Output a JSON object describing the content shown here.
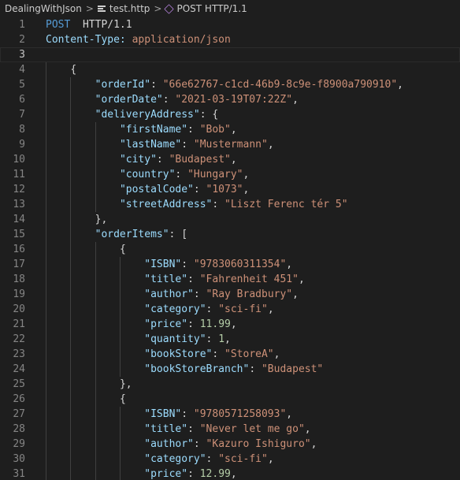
{
  "breadcrumb": {
    "folder": "DealingWithJson",
    "file": "test.http",
    "request": "POST HTTP/1.1",
    "separator": ">"
  },
  "colors": {
    "background": "#1e1e1e",
    "line_number": "#858585",
    "keyword": "#569cd6",
    "property": "#9cdcfe",
    "string": "#ce9178",
    "number": "#b5cea8",
    "punctuation": "#d4d4d4"
  },
  "icons": {
    "file": "file-lines-icon",
    "request": "method-cube-icon"
  },
  "editor": {
    "current_line": 3,
    "lines": [
      {
        "n": "1",
        "indent": 0,
        "tokens": [
          [
            "k",
            "POST"
          ],
          [
            "p",
            "  HTTP/1.1"
          ]
        ]
      },
      {
        "n": "2",
        "indent": 0,
        "tokens": [
          [
            "h",
            "Content-Type:"
          ],
          [
            "s",
            " application/json"
          ]
        ]
      },
      {
        "n": "3",
        "indent": 0,
        "tokens": []
      },
      {
        "n": "4",
        "indent": 1,
        "tokens": [
          [
            "p",
            "{"
          ]
        ]
      },
      {
        "n": "5",
        "indent": 2,
        "tokens": [
          [
            "h",
            "\"orderId\""
          ],
          [
            "p",
            ": "
          ],
          [
            "s",
            "\"66e62767-c1cd-46b9-8c9e-f8900a790910\""
          ],
          [
            "p",
            ","
          ]
        ]
      },
      {
        "n": "6",
        "indent": 2,
        "tokens": [
          [
            "h",
            "\"orderDate\""
          ],
          [
            "p",
            ": "
          ],
          [
            "s",
            "\"2021-03-19T07:22Z\""
          ],
          [
            "p",
            ","
          ]
        ]
      },
      {
        "n": "7",
        "indent": 2,
        "tokens": [
          [
            "h",
            "\"deliveryAddress\""
          ],
          [
            "p",
            ": {"
          ]
        ]
      },
      {
        "n": "8",
        "indent": 3,
        "tokens": [
          [
            "h",
            "\"firstName\""
          ],
          [
            "p",
            ": "
          ],
          [
            "s",
            "\"Bob\""
          ],
          [
            "p",
            ","
          ]
        ]
      },
      {
        "n": "9",
        "indent": 3,
        "tokens": [
          [
            "h",
            "\"lastName\""
          ],
          [
            "p",
            ": "
          ],
          [
            "s",
            "\"Mustermann\""
          ],
          [
            "p",
            ","
          ]
        ]
      },
      {
        "n": "10",
        "indent": 3,
        "tokens": [
          [
            "h",
            "\"city\""
          ],
          [
            "p",
            ": "
          ],
          [
            "s",
            "\"Budapest\""
          ],
          [
            "p",
            ","
          ]
        ]
      },
      {
        "n": "11",
        "indent": 3,
        "tokens": [
          [
            "h",
            "\"country\""
          ],
          [
            "p",
            ": "
          ],
          [
            "s",
            "\"Hungary\""
          ],
          [
            "p",
            ","
          ]
        ]
      },
      {
        "n": "12",
        "indent": 3,
        "tokens": [
          [
            "h",
            "\"postalCode\""
          ],
          [
            "p",
            ": "
          ],
          [
            "s",
            "\"1073\""
          ],
          [
            "p",
            ","
          ]
        ]
      },
      {
        "n": "13",
        "indent": 3,
        "tokens": [
          [
            "h",
            "\"streetAddress\""
          ],
          [
            "p",
            ": "
          ],
          [
            "s",
            "\"Liszt Ferenc tér 5\""
          ]
        ]
      },
      {
        "n": "14",
        "indent": 2,
        "tokens": [
          [
            "p",
            "},"
          ]
        ]
      },
      {
        "n": "15",
        "indent": 2,
        "tokens": [
          [
            "h",
            "\"orderItems\""
          ],
          [
            "p",
            ": ["
          ]
        ]
      },
      {
        "n": "16",
        "indent": 3,
        "tokens": [
          [
            "p",
            "{"
          ]
        ]
      },
      {
        "n": "17",
        "indent": 4,
        "tokens": [
          [
            "h",
            "\"ISBN\""
          ],
          [
            "p",
            ": "
          ],
          [
            "s",
            "\"9783060311354\""
          ],
          [
            "p",
            ","
          ]
        ]
      },
      {
        "n": "18",
        "indent": 4,
        "tokens": [
          [
            "h",
            "\"title\""
          ],
          [
            "p",
            ": "
          ],
          [
            "s",
            "\"Fahrenheit 451\""
          ],
          [
            "p",
            ","
          ]
        ]
      },
      {
        "n": "19",
        "indent": 4,
        "tokens": [
          [
            "h",
            "\"author\""
          ],
          [
            "p",
            ": "
          ],
          [
            "s",
            "\"Ray Bradbury\""
          ],
          [
            "p",
            ","
          ]
        ]
      },
      {
        "n": "20",
        "indent": 4,
        "tokens": [
          [
            "h",
            "\"category\""
          ],
          [
            "p",
            ": "
          ],
          [
            "s",
            "\"sci-fi\""
          ],
          [
            "p",
            ","
          ]
        ]
      },
      {
        "n": "21",
        "indent": 4,
        "tokens": [
          [
            "h",
            "\"price\""
          ],
          [
            "p",
            ": "
          ],
          [
            "n",
            "11.99"
          ],
          [
            "p",
            ","
          ]
        ]
      },
      {
        "n": "22",
        "indent": 4,
        "tokens": [
          [
            "h",
            "\"quantity\""
          ],
          [
            "p",
            ": "
          ],
          [
            "n",
            "1"
          ],
          [
            "p",
            ","
          ]
        ]
      },
      {
        "n": "23",
        "indent": 4,
        "tokens": [
          [
            "h",
            "\"bookStore\""
          ],
          [
            "p",
            ": "
          ],
          [
            "s",
            "\"StoreA\""
          ],
          [
            "p",
            ","
          ]
        ]
      },
      {
        "n": "24",
        "indent": 4,
        "tokens": [
          [
            "h",
            "\"bookStoreBranch\""
          ],
          [
            "p",
            ": "
          ],
          [
            "s",
            "\"Budapest\""
          ]
        ]
      },
      {
        "n": "25",
        "indent": 3,
        "tokens": [
          [
            "p",
            "},"
          ]
        ]
      },
      {
        "n": "26",
        "indent": 3,
        "tokens": [
          [
            "p",
            "{"
          ]
        ]
      },
      {
        "n": "27",
        "indent": 4,
        "tokens": [
          [
            "h",
            "\"ISBN\""
          ],
          [
            "p",
            ": "
          ],
          [
            "s",
            "\"9780571258093\""
          ],
          [
            "p",
            ","
          ]
        ]
      },
      {
        "n": "28",
        "indent": 4,
        "tokens": [
          [
            "h",
            "\"title\""
          ],
          [
            "p",
            ": "
          ],
          [
            "s",
            "\"Never let me go\""
          ],
          [
            "p",
            ","
          ]
        ]
      },
      {
        "n": "29",
        "indent": 4,
        "tokens": [
          [
            "h",
            "\"author\""
          ],
          [
            "p",
            ": "
          ],
          [
            "s",
            "\"Kazuro Ishiguro\""
          ],
          [
            "p",
            ","
          ]
        ]
      },
      {
        "n": "30",
        "indent": 4,
        "tokens": [
          [
            "h",
            "\"category\""
          ],
          [
            "p",
            ": "
          ],
          [
            "s",
            "\"sci-fi\""
          ],
          [
            "p",
            ","
          ]
        ]
      },
      {
        "n": "31",
        "indent": 4,
        "tokens": [
          [
            "h",
            "\"price\""
          ],
          [
            "p",
            ": "
          ],
          [
            "n",
            "12.99"
          ],
          [
            "p",
            ","
          ]
        ]
      }
    ]
  }
}
